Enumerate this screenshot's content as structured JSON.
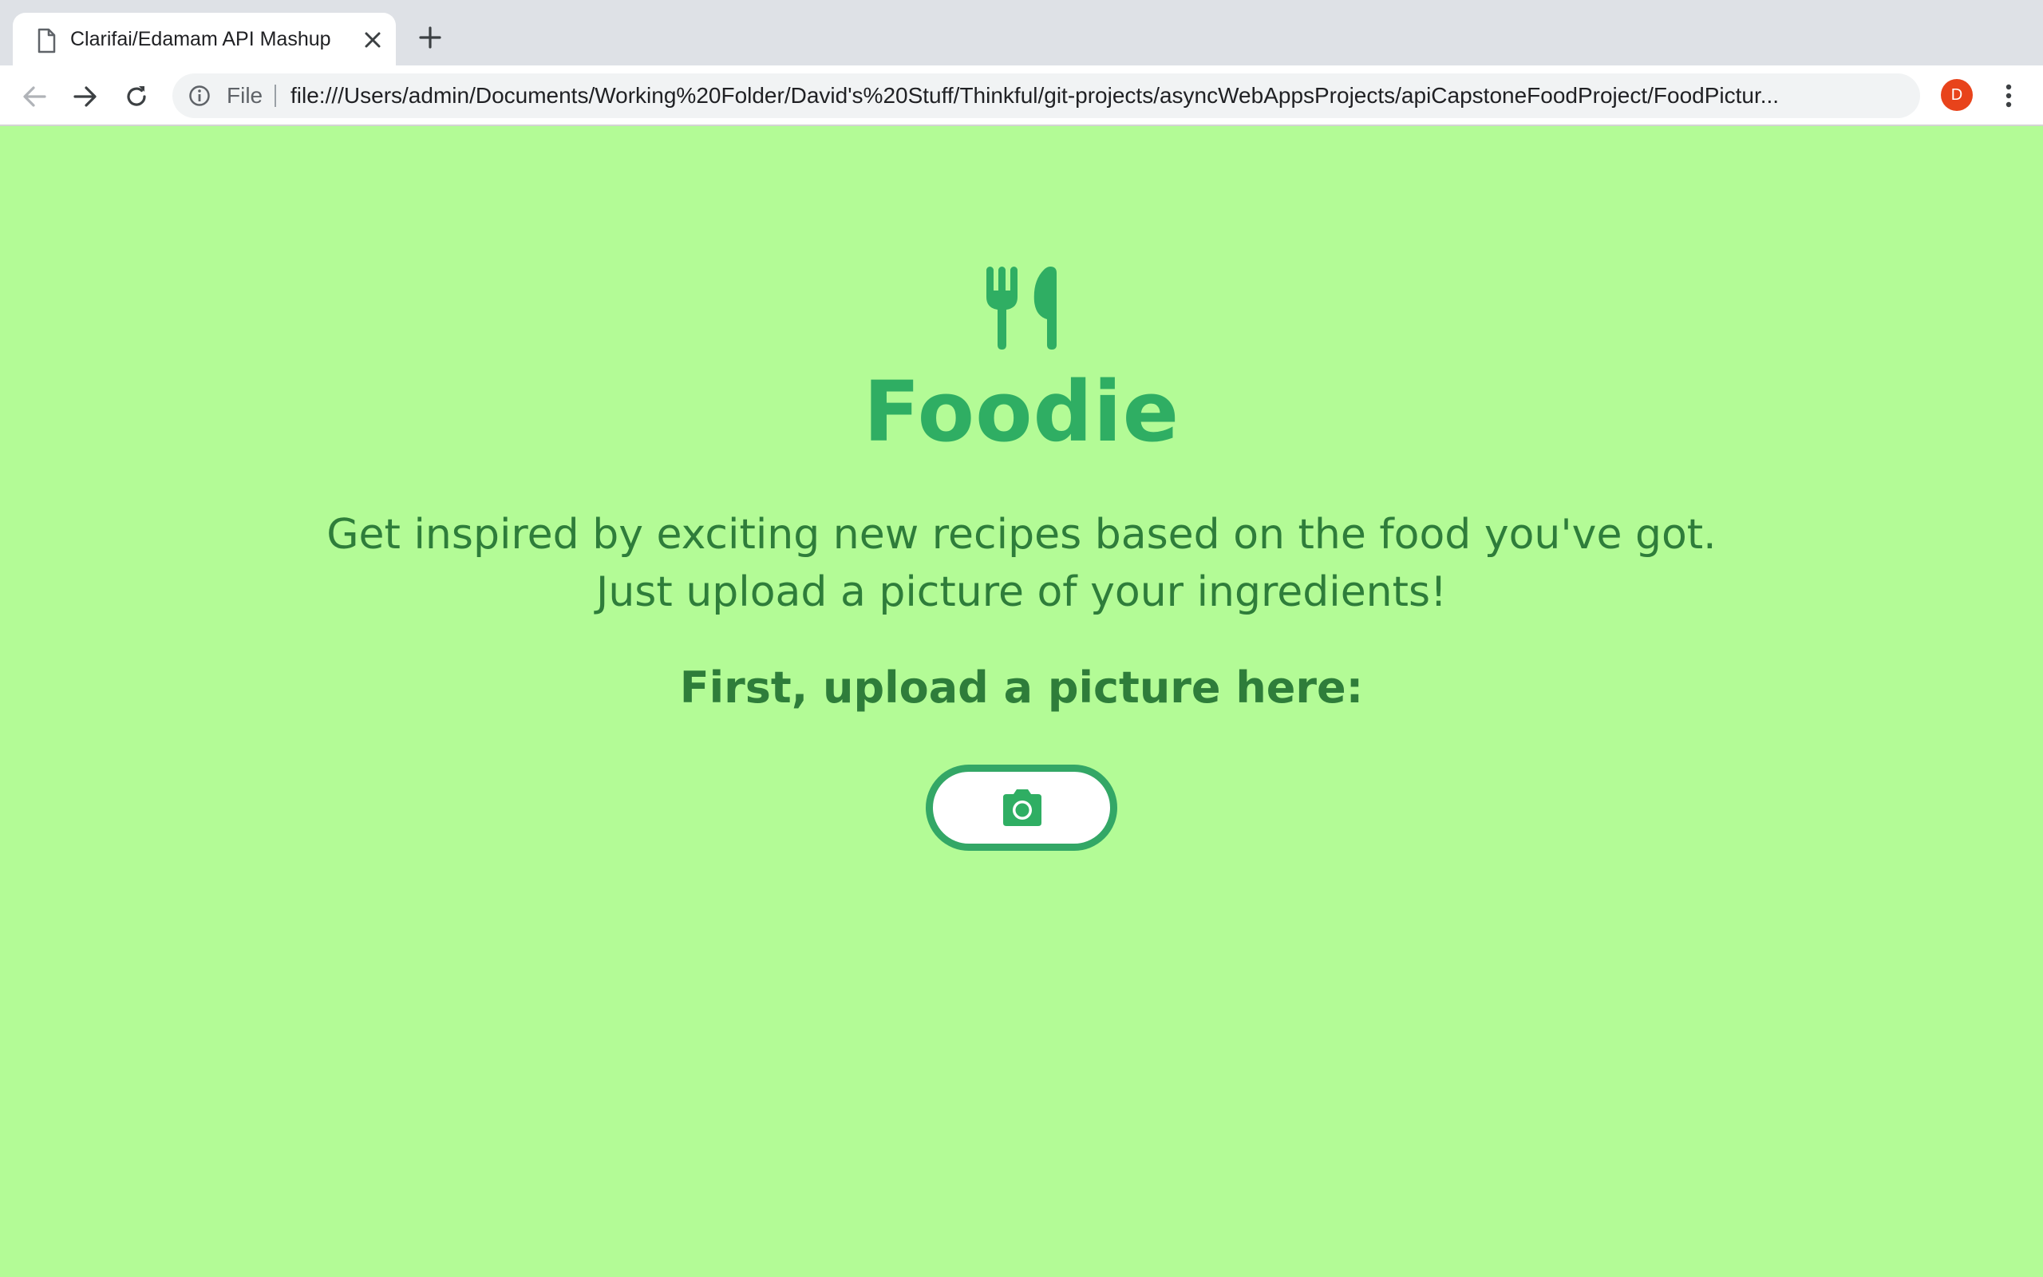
{
  "browser": {
    "tab_title": "Clarifai/Edamam API Mashup",
    "address_scheme_label": "File",
    "url": "file:///Users/admin/Documents/Working%20Folder/David's%20Stuff/Thinkful/git-projects/asyncWebAppsProjects/apiCapstoneFoodProject/FoodPictur...",
    "profile_initial": "D",
    "profile_color": "#e8431b"
  },
  "page": {
    "logo_text": "Foodie",
    "tagline": "Get inspired by exciting new recipes based on the food you've got. Just upload a picture of your ingredients!",
    "upload_prompt": "First, upload a picture here:",
    "upload_icon": "camera-icon",
    "colors": {
      "background": "#b3fb96",
      "brand": "#2fae63",
      "text": "#2e7d3a"
    }
  }
}
